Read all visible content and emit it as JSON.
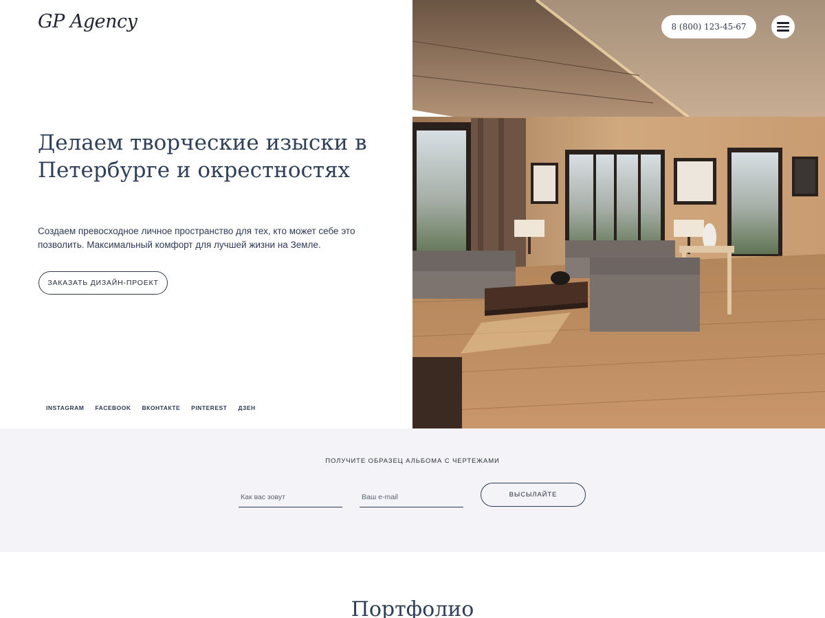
{
  "header": {
    "logo": "GP Agency",
    "phone": "8 (800) 123-45-67",
    "menu_icon": "hamburger-menu-icon"
  },
  "hero": {
    "headline": "Делаем творческие изыски в Петербурге и окрестностях",
    "lead": "Создаем превосходное личное пространство для тех, кто может себе это позволить. Максимальный комфорт для лучшей жизни на Земле.",
    "cta_label": "ЗАКАЗАТЬ ДИЗАЙН-ПРОЕКТ",
    "image": "living-room-interior-photo"
  },
  "socials": [
    {
      "label": "INSTAGRAM"
    },
    {
      "label": "FACEBOOK"
    },
    {
      "label": "ВКОНТАКТЕ"
    },
    {
      "label": "PINTEREST"
    },
    {
      "label": "ДЗЕН"
    }
  ],
  "album_form": {
    "title": "ПОЛУЧИТЕ ОБРАЗЕЦ АЛЬБОМА С ЧЕРТЕЖАМИ",
    "name_placeholder": "Как вас зовут",
    "email_placeholder": "Ваш e-mail",
    "name_value": "",
    "email_value": "",
    "submit_label": "ВЫСЫЛАЙТЕ"
  },
  "portfolio": {
    "title": "Портфолио"
  },
  "colors": {
    "text_dark": "#2f3f57",
    "band_bg": "#f4f4f8",
    "wood": "#b98a5a"
  }
}
